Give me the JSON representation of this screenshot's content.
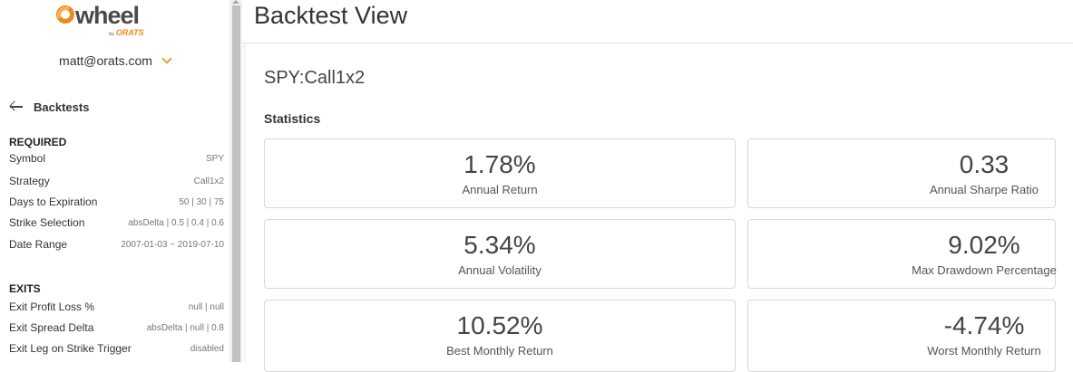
{
  "logo": {
    "word": "wheel",
    "by": "by",
    "brand": "ORATS"
  },
  "user": {
    "email": "matt@orats.com"
  },
  "nav": {
    "back_label": "Backtests"
  },
  "required": {
    "title": "REQUIRED",
    "rows": [
      {
        "label": "Symbol",
        "value": "SPY"
      },
      {
        "label": "Strategy",
        "value": "Call1x2"
      },
      {
        "label": "Days to Expiration",
        "value": "50 | 30 | 75"
      },
      {
        "label": "Strike Selection",
        "value": "absDelta | 0.5 | 0.4 | 0.6"
      },
      {
        "label": "Date Range",
        "value": "2007-01-03 ~ 2019-07-10"
      }
    ]
  },
  "exits": {
    "title": "EXITS",
    "rows": [
      {
        "label": "Exit Profit Loss %",
        "value": "null | null"
      },
      {
        "label": "Exit Spread Delta",
        "value": "absDelta | null | 0.8"
      },
      {
        "label": "Exit Leg on Strike Trigger",
        "value": "disabled"
      }
    ]
  },
  "main": {
    "title": "Backtest View",
    "backtest_name": "SPY:Call1x2",
    "statistics_title": "Statistics",
    "stats": [
      {
        "value": "1.78%",
        "label": "Annual Return"
      },
      {
        "value": "0.33",
        "label": "Annual Sharpe Ratio"
      },
      {
        "value": "5.34%",
        "label": "Annual Volatility"
      },
      {
        "value": "9.02%",
        "label": "Max Drawdown Percentage"
      },
      {
        "value": "10.52%",
        "label": "Best Monthly Return"
      },
      {
        "value": "-4.74%",
        "label": "Worst Monthly Return"
      }
    ]
  },
  "colors": {
    "accent": "#f08a1e",
    "text": "#333333",
    "card_border": "#d7d7d7"
  },
  "icons": {
    "back": "arrow-left-icon",
    "user_menu": "chevron-down-icon"
  }
}
